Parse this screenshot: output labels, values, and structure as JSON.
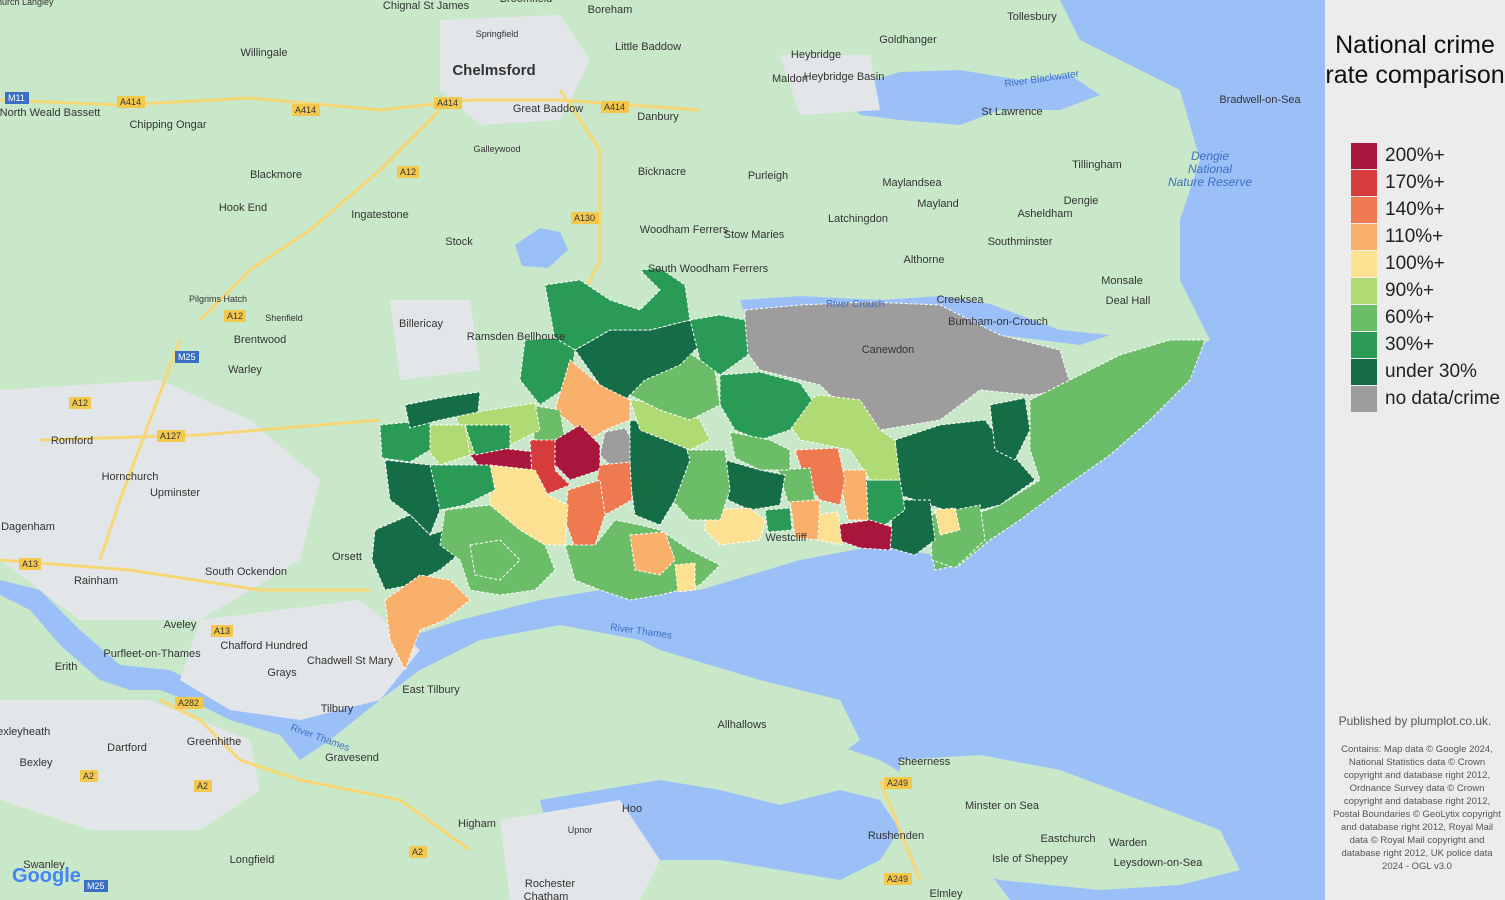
{
  "legend": {
    "title": "National crime rate comparison",
    "items": [
      {
        "label": "200%+",
        "color": "#a8163c"
      },
      {
        "label": "170%+",
        "color": "#d73c3c"
      },
      {
        "label": "140%+",
        "color": "#f07a4f"
      },
      {
        "label": "110%+",
        "color": "#f9b06a"
      },
      {
        "label": "100%+",
        "color": "#fbe191"
      },
      {
        "label": "90%+",
        "color": "#b0db74"
      },
      {
        "label": "60%+",
        "color": "#6cbd68"
      },
      {
        "label": "30%+",
        "color": "#2a9a57"
      },
      {
        "label": "under 30%",
        "color": "#156d47"
      },
      {
        "label": "no data/crime",
        "color": "#9d9d9d"
      }
    ]
  },
  "publisher": "Published by plumplot.co.uk.",
  "attribution": "Contains: Map data © Google 2024, National Statistics data © Crown copyright and database right 2012, Ordnance Survey data © Crown copyright and database right 2012, Postal Boundaries © GeoLytix copyright and database right 2012, Royal Mail data © Royal Mail copyright and database right 2012, UK police data 2024 - OGL v3.0",
  "map": {
    "provider": "Google",
    "places": [
      "Chelmsford",
      "Boreham",
      "Tollesbury",
      "Little Baddow",
      "Heybridge",
      "Goldhanger",
      "Maldon",
      "Heybridge Basin",
      "Willingale",
      "North Weald Bassett",
      "Chipping Ongar",
      "Great Baddow",
      "Danbury",
      "Galleywood",
      "St Lawrence",
      "Bradwell-on-Sea",
      "Tillingham",
      "Bicknacre",
      "Purleigh",
      "Blackmore",
      "Hook End",
      "Ingatestone",
      "Maylandsea",
      "Mayland",
      "Dengie",
      "Asheldham",
      "Latchingdon",
      "Stock",
      "Woodham Ferrers",
      "Stow Maries",
      "Southminster",
      "Althorne",
      "Monsale",
      "South Woodham Ferrers",
      "Creeksea",
      "Deal Hall",
      "Burnham-on-Crouch",
      "Billericay",
      "Brentwood",
      "Shenfield",
      "Pilgrims Hatch",
      "Ramsden Bellhouse",
      "Warley",
      "Canewdon",
      "Romford",
      "Hornchurch",
      "Upminster",
      "Dagenham",
      "South Ockendon",
      "Rainham",
      "Orsett",
      "Aveley",
      "Chafford Hundred",
      "Purfleet-on-Thames",
      "Erith",
      "Grays",
      "Chadwell St Mary",
      "East Tilbury",
      "Tilbury",
      "Allhallows",
      "Bexleyheath",
      "Dartford",
      "Greenhithe",
      "Gravesend",
      "Bexley",
      "Sheerness",
      "Minster on Sea",
      "Rushenden",
      "Hoo",
      "Higham",
      "Upnor",
      "Eastchurch",
      "Warden",
      "Leysdown-on-Sea",
      "Isle of Sheppey",
      "Swanley",
      "Longfield",
      "Rochester",
      "Chatham",
      "Westcliff",
      "Springfield",
      "Chignal St James",
      "Broomfield",
      "Elmley",
      "Church Langley"
    ],
    "water_labels": [
      "River Blackwater",
      "River Crouch",
      "River Thames",
      "Dengie National Nature Reserve"
    ],
    "roads": [
      "M11",
      "A414",
      "A12",
      "A130",
      "M25",
      "A127",
      "A13",
      "A2",
      "A282",
      "A249"
    ]
  }
}
